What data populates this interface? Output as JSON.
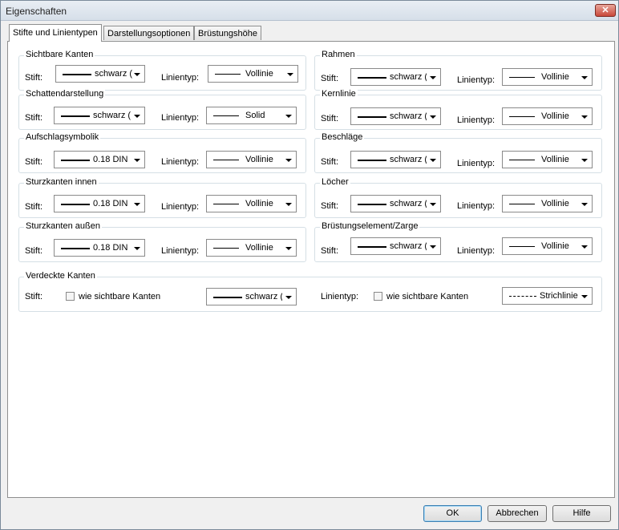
{
  "window": {
    "title": "Eigenschaften",
    "close_glyph": "✕"
  },
  "tabs": [
    "Stifte und Linientypen",
    "Darstellungsoptionen",
    "Brüstungshöhe"
  ],
  "labels": {
    "stift": "Stift:",
    "linientyp": "Linientyp:"
  },
  "groups": [
    {
      "label": "Sichtbare Kanten",
      "pen": "schwarz (",
      "line": "Vollinie"
    },
    {
      "label": "Schattendarstellung",
      "pen": "schwarz (",
      "line": "Solid"
    },
    {
      "label": "Aufschlagsymbolik",
      "pen": "0.18 DIN",
      "line": "Vollinie"
    },
    {
      "label": "Sturzkanten innen",
      "pen": "0.18 DIN",
      "line": "Vollinie"
    },
    {
      "label": "Sturzkanten außen",
      "pen": "0.18 DIN",
      "line": "Vollinie"
    },
    {
      "label": "Rahmen",
      "pen": "schwarz (",
      "line": "Vollinie"
    },
    {
      "label": "Kernlinie",
      "pen": "schwarz (",
      "line": "Vollinie"
    },
    {
      "label": "Beschläge",
      "pen": "schwarz (",
      "line": "Vollinie"
    },
    {
      "label": "Löcher",
      "pen": "schwarz (",
      "line": "Vollinie"
    },
    {
      "label": "Brüstungselement/Zarge",
      "pen": "schwarz (",
      "line": "Vollinie"
    }
  ],
  "hidden": {
    "label": "Verdeckte Kanten",
    "same_pen_label": "wie sichtbare Kanten",
    "pen": "schwarz (",
    "same_line_label": "wie sichtbare Kanten",
    "line": "Strichlinie"
  },
  "buttons": {
    "ok": "OK",
    "cancel": "Abbrechen",
    "help": "Hilfe"
  }
}
